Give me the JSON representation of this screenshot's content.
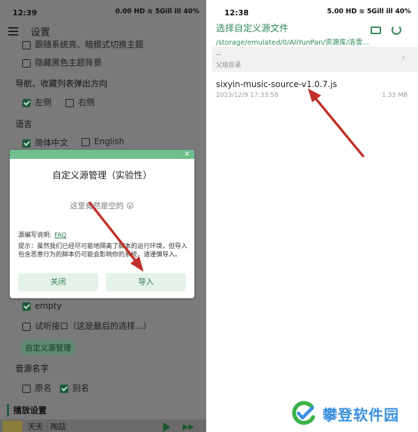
{
  "left": {
    "status": {
      "time": "12:39",
      "icons": "0.00 HD ≋ 5Gill ill 40%"
    },
    "header": {
      "title": "设置"
    },
    "theme": {
      "follow_system": "跟随系统亮、暗模式切换主题",
      "hide_black_bg": "隐藏黑色主题背景"
    },
    "nav": {
      "heading": "导航、收藏列表弹出方向",
      "left": "左侧",
      "right": "右侧"
    },
    "lang": {
      "heading": "语言",
      "zh": "简体中文",
      "en": "English"
    },
    "dialog": {
      "close": "×",
      "title": "自定义源管理（实验性）",
      "empty": "这里竟然是空的 😲",
      "faq_label": "源编写说明:",
      "faq_link": "FAQ",
      "note": "提示：虽然我们已经尽可能地隔离了脚本的运行环境，但导入包含恶意行为的脚本仍可能会影响你的系统，请谨慎导入。",
      "btn_close": "关闭",
      "btn_import": "导入"
    },
    "source": {
      "empty": "empty",
      "trial": "试听接口（这是最后的选择...）",
      "custom_btn": "自定义源管理"
    },
    "name": {
      "heading": "音源名字",
      "orig": "原名",
      "alias": "别名"
    },
    "play": {
      "heading": "播放设置"
    },
    "player": {
      "song": "天天 · 陶喆"
    }
  },
  "right": {
    "status": {
      "time": "12:38",
      "icons": "5.00 HD ≋ 5Gill ill 40%"
    },
    "title": "选择自定义源文件",
    "path": "/storage/emulated/0/AliYunPan/资源库/洛雪...",
    "parent": {
      "dots": "..",
      "label": "父级目录"
    },
    "file": {
      "name": "sixyin-music-source-v1.0.7.js",
      "date": "2023/12/9 17:33:58",
      "size": "1.33 MB"
    }
  },
  "watermark": {
    "text": "攀登软件园"
  },
  "colors": {
    "accent": "#2f8a57",
    "arrow": "#c0302a",
    "dim": "#7a7a7a"
  }
}
